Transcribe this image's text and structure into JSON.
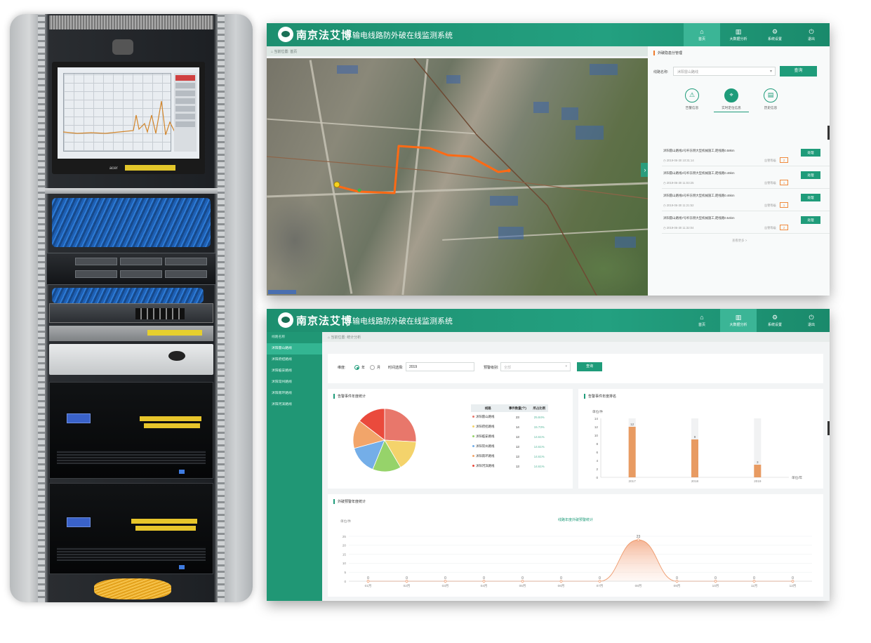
{
  "brand": {
    "name": "南京法艾博",
    "system_title": "输电线路防外破在线监测系统"
  },
  "nav": [
    {
      "label": "首页",
      "icon": "home-icon"
    },
    {
      "label": "大数据分析",
      "icon": "bar-chart-icon"
    },
    {
      "label": "系统设置",
      "icon": "gear-icon"
    },
    {
      "label": "退出",
      "icon": "power-icon"
    }
  ],
  "screen1": {
    "active_nav": 0,
    "crumb": "当前位置: 首页",
    "panel": {
      "title": "外破隐患分管理",
      "field_label": "线路名称:",
      "field_value": "沭阳雷山路线",
      "query": "查询",
      "tabs": [
        {
          "label": "告警信息",
          "icon": "warning-icon"
        },
        {
          "label": "实时定位信息",
          "icon": "location-pin-icon"
        },
        {
          "label": "历史信息",
          "icon": "history-icon"
        }
      ],
      "active_tab": 1,
      "alerts": [
        {
          "text": "沭阳雷山路线2号杆东侧大型机械施工,距线路0.58km",
          "time": "2019-06-30 10:31:14",
          "sub": "告警等级",
          "num": "2",
          "btn": "处理"
        },
        {
          "text": "沭阳雷山路线3号杆东侧大型机械施工,距线路0.46km",
          "time": "2019-06-30 11:03:25",
          "sub": "告警等级",
          "num": "1",
          "btn": "处理"
        },
        {
          "text": "沭阳雷山路线5号杆东侧大型机械施工,距线路0.46km",
          "time": "2019-06-30 11:21:52",
          "sub": "告警等级",
          "num": "1",
          "btn": "处理"
        },
        {
          "text": "沭阳雷山路线7号杆东侧大型机械施工,距线路0.54km",
          "time": "2019-06-30 11:32:04",
          "sub": "告警等级",
          "num": "2",
          "btn": "处理"
        }
      ],
      "pager": "查看更多 >"
    }
  },
  "screen2": {
    "active_nav": 1,
    "crumb": "当前位置: 统计分析",
    "sidebar_head": "线路名称",
    "sidebar": [
      "沭阳雷山路线",
      "沭阳府招路线",
      "沭阳临安路线",
      "沭阳常州路线",
      "沭阳南环路线",
      "沭阳河滨路线"
    ],
    "active_item": 0,
    "filter": {
      "mode_label": "维度:",
      "year_label": "年",
      "month_label": "月",
      "time_label": "时间选择:",
      "time_value": "2019",
      "level_label": "预警级别:",
      "level_placeholder": "全部",
      "query": "查询"
    },
    "pie_title": "告警事件年度统计",
    "bar_title": "告警事件年度排名",
    "line_title": "外破预警年度统计"
  },
  "colors": {
    "primary": "#1f9c7a",
    "header": "#23a080",
    "accent_orange": "#f07b2c"
  },
  "chart_data": [
    {
      "type": "pie",
      "table_headers": [
        "线路",
        "事件数量(个)",
        "所占比例"
      ],
      "slices": [
        {
          "name": "沭阳雷山路线",
          "value": 23,
          "pct": "25.84%",
          "color": "#e8776b"
        },
        {
          "name": "沭阳府招路线",
          "value": 14,
          "pct": "15.73%",
          "color": "#f4d36b"
        },
        {
          "name": "沭阳临安路线",
          "value": 13,
          "pct": "14.61%",
          "color": "#96d36a"
        },
        {
          "name": "沭阳常州路线",
          "value": 13,
          "pct": "14.61%",
          "color": "#74aee8"
        },
        {
          "name": "沭阳南环路线",
          "value": 13,
          "pct": "14.61%",
          "color": "#f2a56a"
        },
        {
          "name": "沭阳河滨路线",
          "value": 13,
          "pct": "14.61%",
          "color": "#ea4a3c"
        }
      ]
    },
    {
      "type": "bar",
      "ylabel": "单位/件",
      "xlabel": "单位/年",
      "ylim": [
        0,
        14
      ],
      "yticks": [
        0,
        2,
        4,
        6,
        8,
        10,
        12,
        14
      ],
      "categories": [
        "2017",
        "2018",
        "2019"
      ],
      "values": [
        12,
        9,
        3
      ],
      "labels": [
        "12",
        "9",
        "3"
      ]
    },
    {
      "type": "area",
      "title": "线路年度外破预警统计",
      "ylabel": "单位/件",
      "ylim": [
        0,
        25
      ],
      "yticks": [
        0,
        5,
        10,
        15,
        20,
        25
      ],
      "categories": [
        "01月",
        "02月",
        "03月",
        "04月",
        "05月",
        "06月",
        "07月",
        "08月",
        "09月",
        "10月",
        "11月",
        "12月"
      ],
      "values": [
        0,
        0,
        0,
        0,
        0,
        0,
        0,
        23,
        0,
        0,
        0,
        0
      ]
    }
  ]
}
